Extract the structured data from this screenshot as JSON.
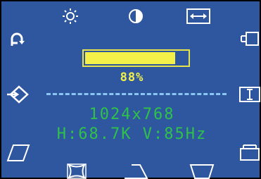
{
  "osd": {
    "top_icons": [
      "brightness-icon",
      "contrast-icon",
      "horizontal-size-icon"
    ],
    "left_icons": [
      "auto-adjust-icon",
      "input-source-icon",
      "parallelogram-icon"
    ],
    "right_icons": [
      "horizontal-position-icon",
      "vertical-size-icon",
      "vertical-position-icon"
    ],
    "bottom_icons": [
      "pincushion-icon",
      "trapezoid-icon",
      "reverse-trapezoid-icon"
    ],
    "brightness": {
      "value": 0.88,
      "percent_label": "88%"
    },
    "resolution": "1024x768",
    "frequency": "H:68.7K V:85Hz",
    "colors": {
      "background": "#2f57a0",
      "bar": "#f3f04a",
      "text_green": "#2fc24a",
      "separator": "#8ac6f2"
    }
  }
}
